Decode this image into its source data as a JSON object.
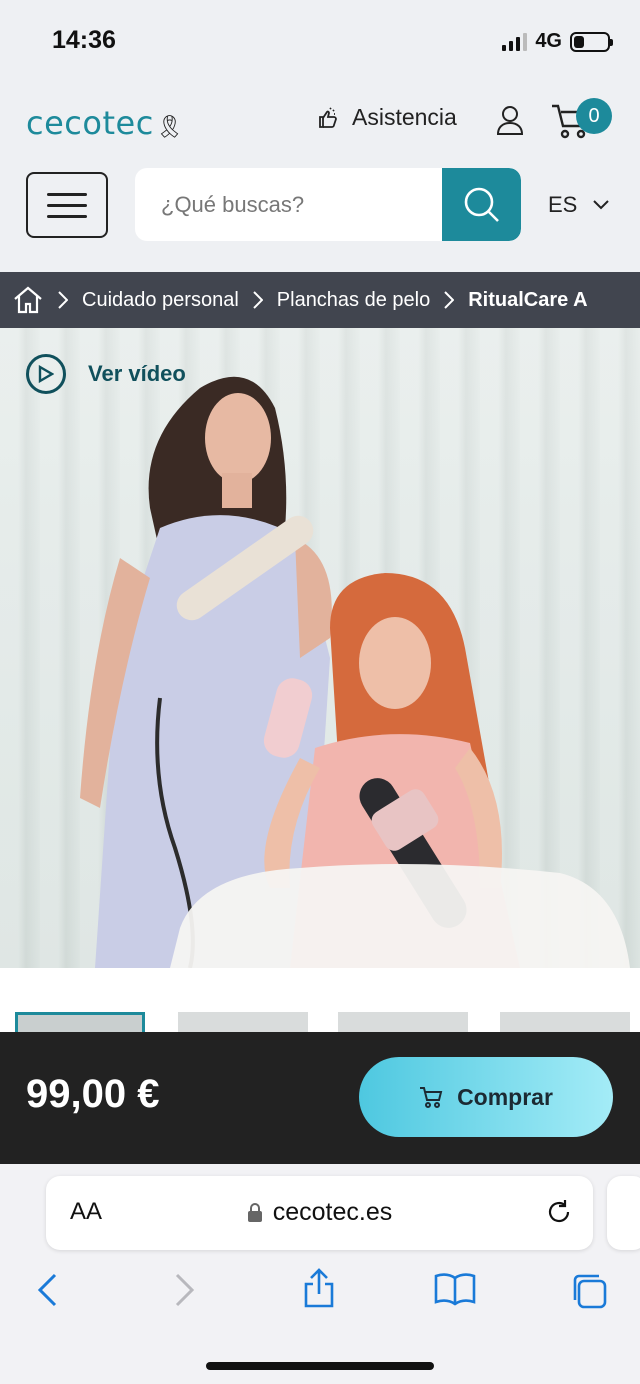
{
  "status_bar": {
    "time": "14:36",
    "network": "4G",
    "battery_level": 0.3
  },
  "header": {
    "logo_text": "cecotec",
    "assist_label": "Asistencia",
    "cart_count": "0",
    "search_placeholder": "¿Qué buscas?",
    "language": "ES",
    "accent_color": "#1d8a9b"
  },
  "breadcrumb": {
    "items": [
      "Cuidado personal",
      "Planchas de pelo"
    ],
    "current": "RitualCare A"
  },
  "hero": {
    "video_label": "Ver vídeo"
  },
  "buy_bar": {
    "price": "99,00 €",
    "buy_label": "Comprar"
  },
  "browser": {
    "text_size_label": "AA",
    "url": "cecotec.es"
  }
}
